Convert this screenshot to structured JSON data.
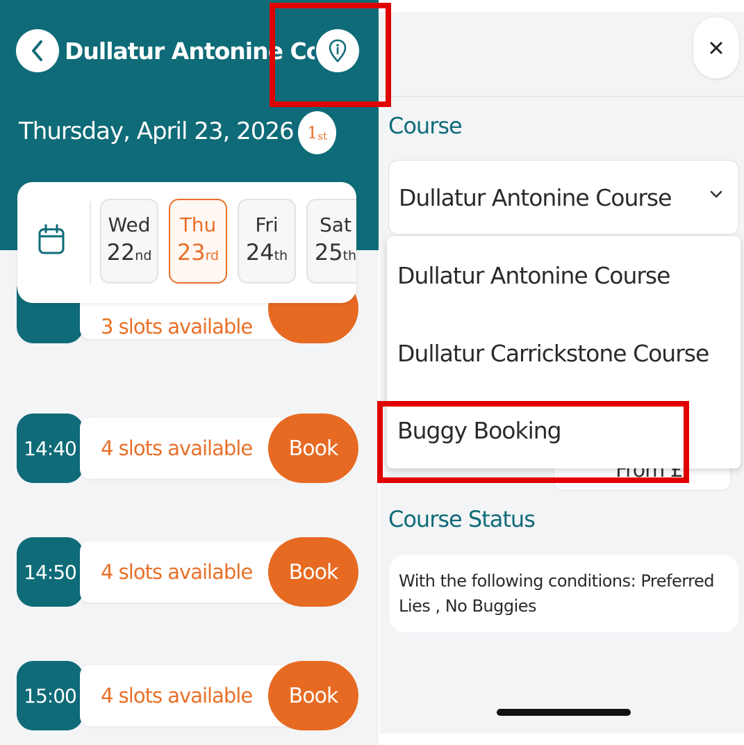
{
  "left_panel": {
    "header": {
      "course_title": "Dullatur Antonine Course",
      "back_icon": "chevron-left-icon",
      "info_icon": "map-pin-info-icon",
      "date": "Thursday, April 23, 2026",
      "first_badge": {
        "num": "1",
        "suffix": "st"
      },
      "colors": {
        "header_bg": "#0f6b78",
        "accent": "#e8702a"
      }
    },
    "days": [
      {
        "name": "Wed",
        "num": "22",
        "suffix": "nd",
        "selected": false
      },
      {
        "name": "Thu",
        "num": "23",
        "suffix": "rd",
        "selected": true
      },
      {
        "name": "Fri",
        "num": "24",
        "suffix": "th",
        "selected": false
      },
      {
        "name": "Sat",
        "num": "25",
        "suffix": "th",
        "selected": false
      }
    ],
    "calendar_icon": "calendar-icon",
    "partial_slot": {
      "text": "3 slots available"
    },
    "slots": [
      {
        "time": "14:40",
        "availability": "4 slots available",
        "action": "Book"
      },
      {
        "time": "14:50",
        "availability": "4 slots available",
        "action": "Book"
      },
      {
        "time": "15:00",
        "availability": "4 slots available",
        "action": "Book"
      }
    ]
  },
  "right_panel": {
    "close_icon": "close-icon",
    "course_label": "Course",
    "course_select": {
      "value": "Dullatur Antonine Course",
      "chevron_icon": "chevron-down-icon"
    },
    "dropdown_options": [
      "Dullatur Antonine Course",
      "Dullatur Carrickstone Course",
      "Buggy Booking"
    ],
    "hidden_field_text": "From £",
    "status_label": "Course Status",
    "status_text": "With the following conditions: Preferred Lies , No Buggies"
  }
}
